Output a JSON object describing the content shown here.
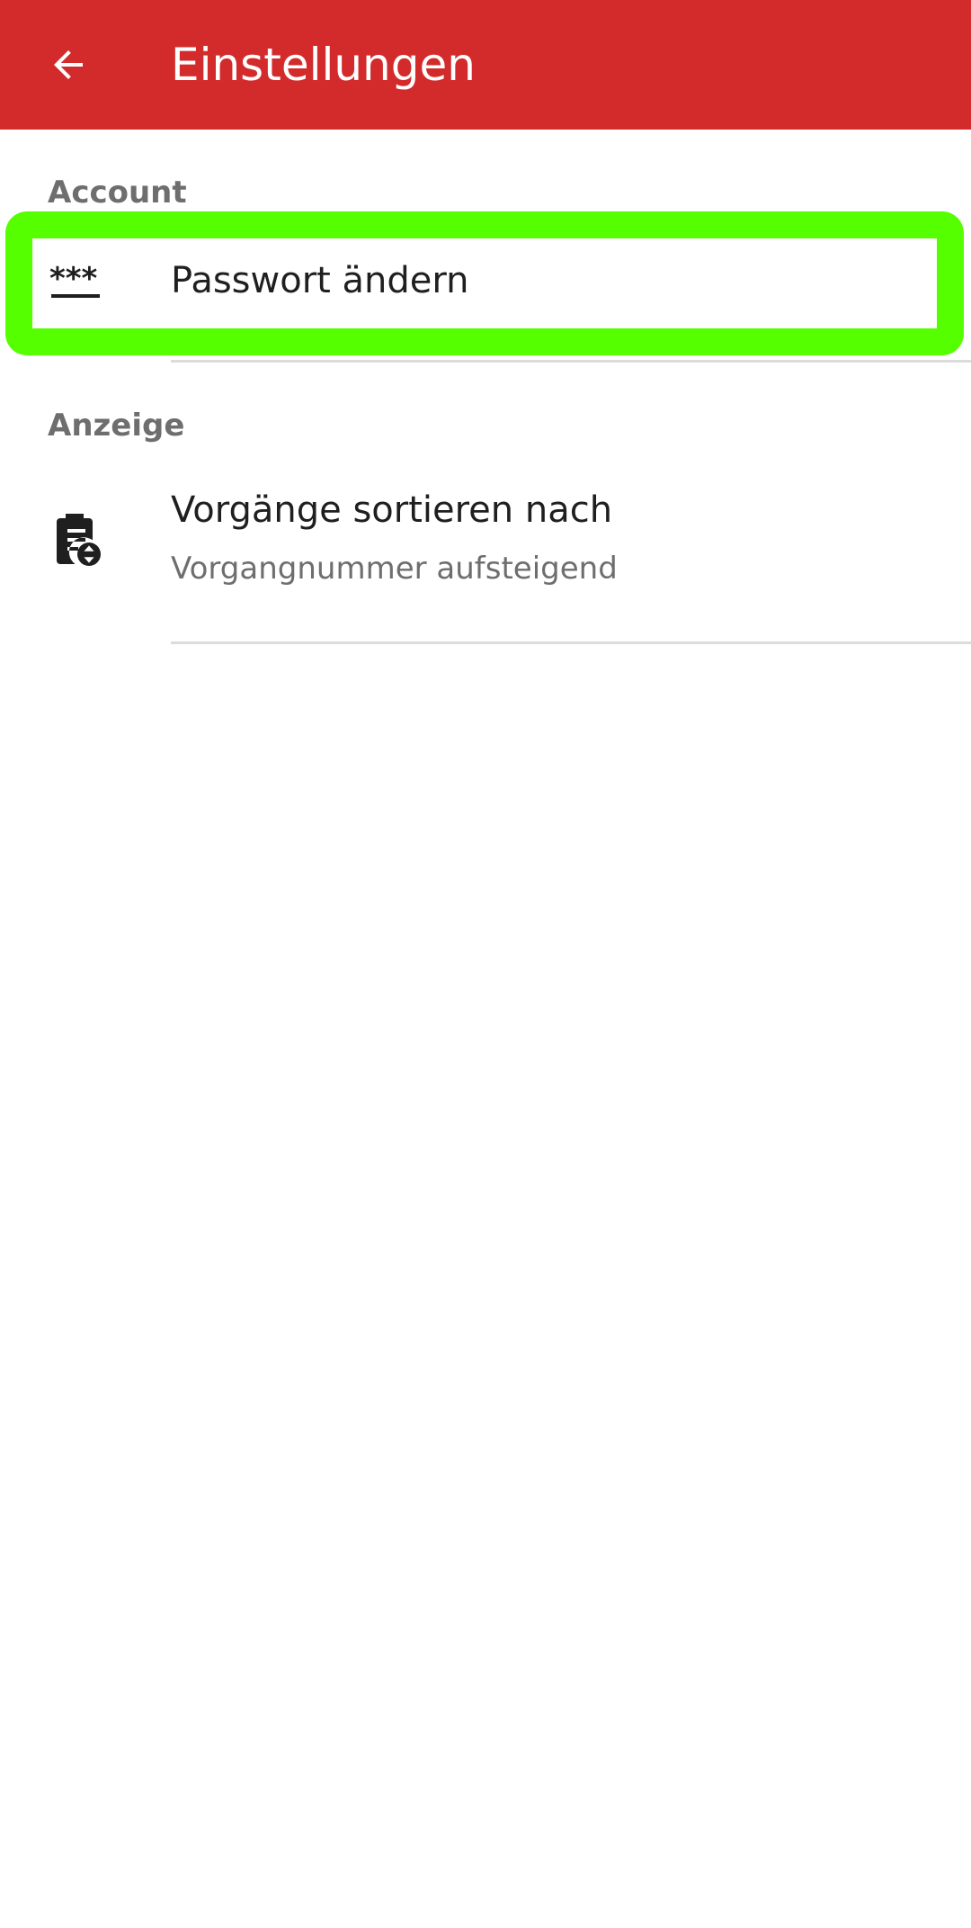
{
  "appbar": {
    "title": "Einstellungen",
    "back_icon": "arrow-back-icon",
    "background_color": "#d32b2b"
  },
  "sections": [
    {
      "header": "Account",
      "items": [
        {
          "title": "Passwort ändern",
          "icon": "password-icon"
        }
      ]
    },
    {
      "header": "Anzeige",
      "items": [
        {
          "title": "Vorgänge sortieren nach",
          "summary": "Vorgangnummer aufsteigend",
          "icon": "clipboard-sort-icon"
        }
      ]
    }
  ],
  "highlight_color": "#55ff00"
}
